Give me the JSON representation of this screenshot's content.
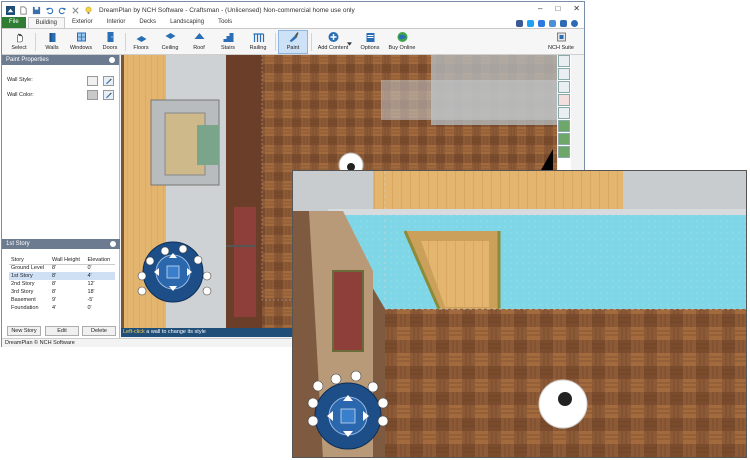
{
  "window": {
    "title": "DreamPlan by NCH Software - Craftsman - (Unlicensed) Non-commercial home use only",
    "controls": [
      "–",
      "□",
      "✕"
    ]
  },
  "tabs": [
    {
      "label": "File"
    },
    {
      "label": "Building"
    },
    {
      "label": "Exterior"
    },
    {
      "label": "Interior"
    },
    {
      "label": "Decks"
    },
    {
      "label": "Landscaping"
    },
    {
      "label": "Tools"
    }
  ],
  "toolbar": {
    "select": "Select",
    "walls": "Walls",
    "windows": "Windows",
    "doors": "Doors",
    "floors": "Floors",
    "ceiling": "Ceiling",
    "roof": "Roof",
    "stairs": "Stairs",
    "railing": "Railing",
    "paint": "Paint",
    "add_content": "Add Content",
    "options": "Options",
    "buy_online": "Buy Online",
    "nch_suite": "NCH Suite"
  },
  "paint_panel": {
    "title": "Paint Properties",
    "wall_style_label": "Wall Style:",
    "wall_color_label": "Wall Color:"
  },
  "story_panel": {
    "title": "1st Story",
    "headers": [
      "Story",
      "Wall Height",
      "Elevation"
    ],
    "rows": [
      [
        "Ground Level",
        "8'",
        "0'"
      ],
      [
        "1st Story",
        "8'",
        "4'"
      ],
      [
        "2nd Story",
        "8'",
        "12'"
      ],
      [
        "3rd Story",
        "8'",
        "18'"
      ],
      [
        "Basement",
        "9'",
        "-5'"
      ],
      [
        "Foundation",
        "4'",
        "0'"
      ]
    ],
    "buttons": [
      "New Story",
      "Edit",
      "Delete"
    ]
  },
  "hint": {
    "highlight": "Left-click",
    "rest": " a wall to change its style"
  },
  "status": "DreamPlan © NCH Software",
  "colors": {
    "accent": "#1f4e79",
    "file_tab": "#2e7d32",
    "panel_header": "#6d7b90",
    "pool_water": "#7fd6e6",
    "floor_wood": "#8a5a3a"
  }
}
